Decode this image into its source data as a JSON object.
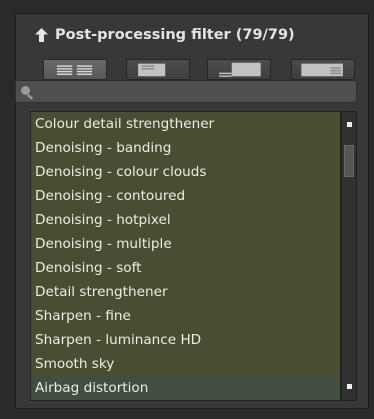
{
  "header": {
    "title": "Post-processing filter (79/79)",
    "collapse_icon": "up-arrow-icon"
  },
  "view_buttons": [
    {
      "icon": "grid-view-icon",
      "active": true
    },
    {
      "icon": "thumbnail-view-icon",
      "active": false
    },
    {
      "icon": "thumbnail-bottom-caption-view-icon",
      "active": false
    },
    {
      "icon": "thumbnail-right-caption-view-icon",
      "active": false
    }
  ],
  "search": {
    "icon": "search-icon",
    "value": "",
    "placeholder": ""
  },
  "filters": [
    "Colour detail strengthener",
    "Denoising - banding",
    "Denoising - colour clouds",
    "Denoising - contoured",
    "Denoising - hotpixel",
    "Denoising - multiple",
    "Denoising - soft",
    "Detail strengthener",
    "Sharpen - fine",
    "Sharpen - luminance HD",
    "Smooth sky",
    "Airbag distortion"
  ],
  "selected_index": 11,
  "colors": {
    "list_background": "#4b4d33",
    "selected_row": "#414e41",
    "panel_background": "#383838"
  }
}
